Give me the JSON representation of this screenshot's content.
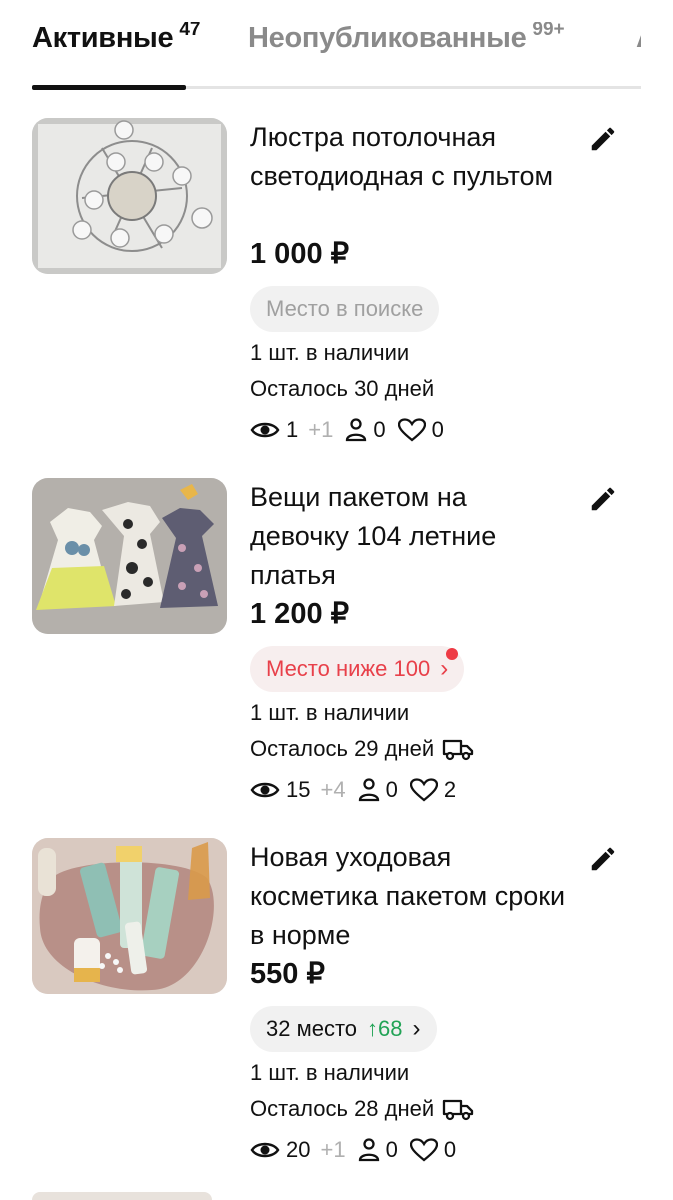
{
  "tabs": [
    {
      "label": "Активные",
      "count": "47"
    },
    {
      "label": "Неопубликованные",
      "count": "99+"
    },
    {
      "label": "А",
      "count": ""
    }
  ],
  "listings": [
    {
      "title": "Люстра потолочная светодиодная с пультом",
      "price": "1 000 ₽",
      "pill": {
        "text": "Место в поиске",
        "style": "gray",
        "has_dot": false,
        "rank_change": ""
      },
      "stock": "1 шт. в наличии",
      "remaining": "Осталось 30 дней",
      "has_delivery": false,
      "views": "1",
      "views_delta": "+1",
      "contacts": "0",
      "favorites": "0",
      "image_icon": "chandelier-photo"
    },
    {
      "title": "Вещи пакетом на девочку 104 летние платья",
      "price": "1 200 ₽",
      "pill": {
        "text": "Место ниже 100",
        "style": "red",
        "has_dot": true,
        "rank_change": ""
      },
      "stock": "1 шт. в наличии",
      "remaining": "Осталось 29 дней",
      "has_delivery": true,
      "views": "15",
      "views_delta": "+4",
      "contacts": "0",
      "favorites": "2",
      "image_icon": "dresses-photo"
    },
    {
      "title": "Новая уходовая косметика пакетом сроки в норме",
      "price": "550 ₽",
      "pill": {
        "text": "32 место",
        "style": "green",
        "has_dot": false,
        "rank_change": "68"
      },
      "stock": "1 шт. в наличии",
      "remaining": "Осталось 28 дней",
      "has_delivery": true,
      "views": "20",
      "views_delta": "+1",
      "contacts": "0",
      "favorites": "0",
      "image_icon": "cosmetics-photo"
    }
  ],
  "icons": {
    "edit": "pencil-icon",
    "views": "eye-icon",
    "contacts": "person-icon",
    "favorites": "heart-icon",
    "delivery": "truck-icon",
    "chevron": "chevron-right-icon",
    "rank_up": "arrow-up-icon"
  },
  "colors": {
    "accent_red": "#e8404a",
    "rank_green": "#22a356",
    "muted": "#8a8a8a"
  }
}
